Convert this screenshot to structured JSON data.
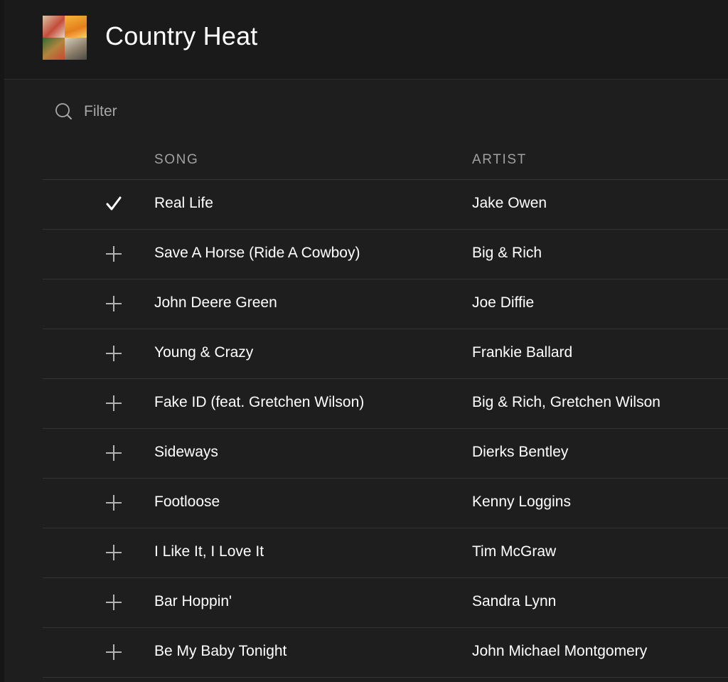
{
  "playlist": {
    "title": "Country Heat",
    "cover_name": "playlist-cover-mosaic"
  },
  "filter": {
    "placeholder": "Filter",
    "value": "",
    "icon": "search-icon"
  },
  "table": {
    "columns": {
      "song": "SONG",
      "artist": "ARTIST"
    },
    "rows": [
      {
        "song": "Real Life",
        "artist": "Jake Owen",
        "status": "added",
        "icon": "check-icon"
      },
      {
        "song": "Save A Horse (Ride A Cowboy)",
        "artist": "Big & Rich",
        "status": "add",
        "icon": "plus-icon"
      },
      {
        "song": "John Deere Green",
        "artist": "Joe Diffie",
        "status": "add",
        "icon": "plus-icon"
      },
      {
        "song": "Young & Crazy",
        "artist": "Frankie Ballard",
        "status": "add",
        "icon": "plus-icon"
      },
      {
        "song": "Fake ID (feat. Gretchen Wilson)",
        "artist": "Big & Rich, Gretchen Wilson",
        "status": "add",
        "icon": "plus-icon"
      },
      {
        "song": "Sideways",
        "artist": "Dierks Bentley",
        "status": "add",
        "icon": "plus-icon"
      },
      {
        "song": "Footloose",
        "artist": "Kenny Loggins",
        "status": "add",
        "icon": "plus-icon"
      },
      {
        "song": "I Like It, I Love It",
        "artist": "Tim McGraw",
        "status": "add",
        "icon": "plus-icon"
      },
      {
        "song": "Bar Hoppin'",
        "artist": "Sandra Lynn",
        "status": "add",
        "icon": "plus-icon"
      },
      {
        "song": "Be My Baby Tonight",
        "artist": "John Michael Montgomery",
        "status": "add",
        "icon": "plus-icon"
      }
    ]
  },
  "colors": {
    "background": "#1e1e1e",
    "header_background": "#1a1a1a",
    "text_primary": "#ffffff",
    "text_secondary": "#a0a0a0",
    "divider": "#333333"
  }
}
